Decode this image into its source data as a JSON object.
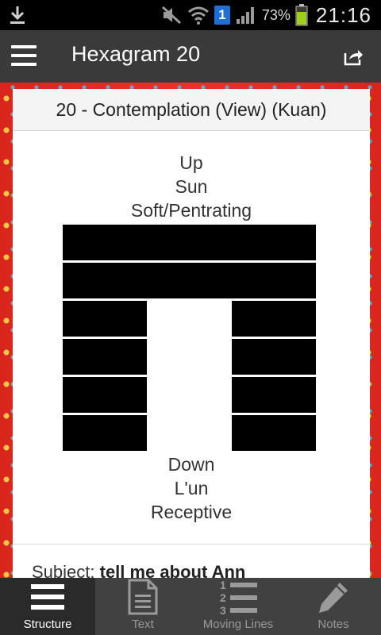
{
  "status_bar": {
    "battery_percent": "73%",
    "time": "21:16",
    "sim_badge": "1",
    "icons": [
      "download-icon",
      "mute-icon",
      "wifi-icon",
      "sim-icon",
      "signal-icon",
      "battery-icon"
    ]
  },
  "app_bar": {
    "title": "Hexagram 20",
    "menu_icon": "menu-icon",
    "share_icon": "share-icon"
  },
  "card": {
    "header": "20 - Contemplation (View) (Kuan)",
    "upper": {
      "role": "Up",
      "name": "Sun",
      "quality": "Soft/Pentrating"
    },
    "lower": {
      "role": "Down",
      "name": "L'un",
      "quality": "Receptive"
    },
    "lines_top_to_bottom": [
      "solid",
      "solid",
      "broken",
      "broken",
      "broken",
      "broken"
    ],
    "subject_label": "Subject:",
    "subject_value": "tell me about Ann"
  },
  "bottom_nav": [
    {
      "label": "Structure",
      "icon": "structure-icon",
      "active": true
    },
    {
      "label": "Text",
      "icon": "document-icon",
      "active": false
    },
    {
      "label": "Moving Lines",
      "icon": "numbered-list-icon",
      "active": false
    },
    {
      "label": "Notes",
      "icon": "pencil-icon",
      "active": false
    }
  ],
  "colors": {
    "app_bar": "#3a3a3a",
    "background_pattern": "#d9261c",
    "bottom_nav": "#414141",
    "sim_badge": "#1e6fd6",
    "battery": "#9bd11c"
  }
}
